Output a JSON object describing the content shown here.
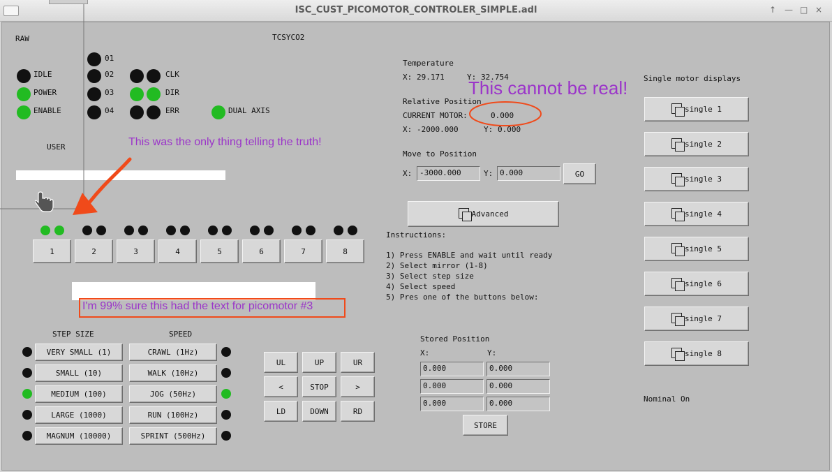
{
  "window": {
    "title": "ISC_CUST_PICOMOTOR_CONTROLER_SIMPLE.adl",
    "buttons": [
      "↑",
      "—",
      "□",
      "×"
    ]
  },
  "header": {
    "raw": "RAW",
    "system": "TCSYCO2",
    "user": "USER"
  },
  "leds_labels": {
    "m01": "01",
    "m02": "02",
    "m03": "03",
    "m04": "04",
    "idle": "IDLE",
    "power": "POWER",
    "enable": "ENABLE",
    "clk": "CLK",
    "dir": "DIR",
    "err": "ERR",
    "dual_axis": "DUAL AXIS"
  },
  "mirrors": [
    "1",
    "2",
    "3",
    "4",
    "5",
    "6",
    "7",
    "8"
  ],
  "step_size": {
    "title": "STEP SIZE",
    "options": [
      "VERY SMALL (1)",
      "SMALL (10)",
      "MEDIUM (100)",
      "LARGE (1000)",
      "MAGNUM (10000)"
    ],
    "active_index": 2
  },
  "speed": {
    "title": "SPEED",
    "options": [
      "CRAWL (1Hz)",
      "WALK (10Hz)",
      "JOG (50Hz)",
      "RUN (100Hz)",
      "SPRINT (500Hz)"
    ],
    "active_index": 2
  },
  "direction": {
    "ul": "UL",
    "up": "UP",
    "ur": "UR",
    "left": "<",
    "stop": "STOP",
    "right": ">",
    "ld": "LD",
    "down": "DOWN",
    "rd": "RD"
  },
  "temperature": {
    "title": "Temperature",
    "x_label": "X:",
    "x": "29.171",
    "y_label": "Y:",
    "y": "32.754"
  },
  "relative": {
    "title": "Relative Position",
    "current_label": "CURRENT MOTOR:",
    "current": "0.000",
    "x_label": "X:",
    "x": "-2000.000",
    "y_label": "Y:",
    "y": "0.000"
  },
  "move": {
    "title": "Move to Position",
    "x_label": "X:",
    "x": "-3000.000",
    "y_label": "Y:",
    "y": "0.000",
    "go": "GO"
  },
  "advanced": "Advanced",
  "instructions": {
    "title": "Instructions:",
    "steps": [
      "1) Press ENABLE and wait until ready",
      "2) Select mirror (1-8)",
      "3) Select step size",
      "4) Select speed",
      "5) Pres one of the buttons below:"
    ]
  },
  "stored": {
    "title": "Stored Position",
    "x_label": "X:",
    "y_label": "Y:",
    "rows": [
      [
        "0.000",
        "0.000"
      ],
      [
        "0.000",
        "0.000"
      ],
      [
        "0.000",
        "0.000"
      ]
    ],
    "store": "STORE"
  },
  "single": {
    "title": "Single motor displays",
    "buttons": [
      "single 1",
      "single 2",
      "single 3",
      "single 4",
      "single 5",
      "single 6",
      "single 7",
      "single 8"
    ]
  },
  "nominal": "Nominal On",
  "annotations": {
    "truth": "This was the only thing telling the truth!",
    "real": "This cannot be real!",
    "picomotor": "I'm 99% sure this had the text for picomotor #3"
  },
  "colors": {
    "led_on": "#22bb22",
    "led_off": "#111111",
    "annotation_text": "#9b35c9",
    "annotation_red": "#f04a1a"
  }
}
